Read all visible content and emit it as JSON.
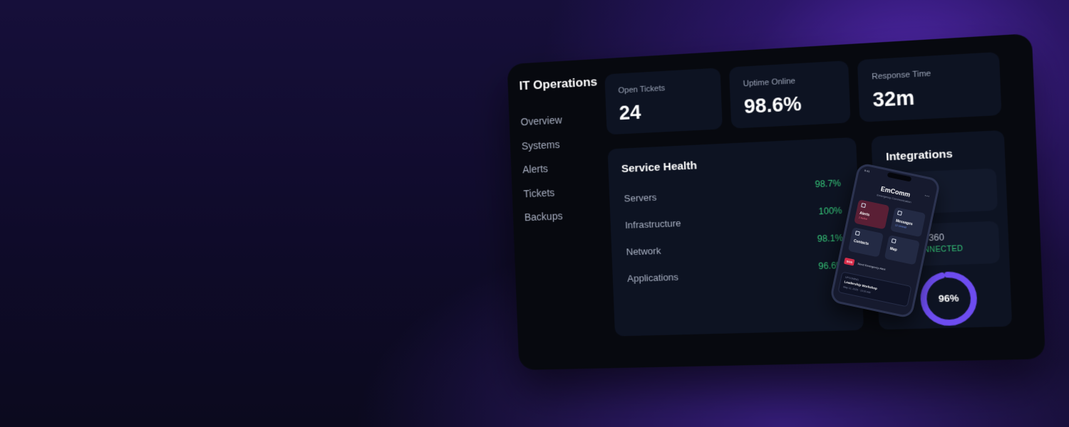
{
  "app": {
    "title": "IT Operations"
  },
  "sidebar": {
    "items": [
      {
        "label": "Overview"
      },
      {
        "label": "Systems"
      },
      {
        "label": "Alerts"
      },
      {
        "label": "Tickets"
      },
      {
        "label": "Backups"
      }
    ]
  },
  "stats": [
    {
      "label": "Open Tickets",
      "value": "24"
    },
    {
      "label": "Uptime Online",
      "value": "98.6%"
    },
    {
      "label": "Response Time",
      "value": "32m"
    }
  ],
  "service_health": {
    "title": "Service Health",
    "rows": [
      {
        "name": "Servers",
        "value": "98.7%"
      },
      {
        "name": "Infrastructure",
        "value": "100%"
      },
      {
        "name": "Network",
        "value": "98.1%"
      },
      {
        "name": "Applications",
        "value": "96.6%"
      }
    ]
  },
  "integrations": {
    "title": "Integrations",
    "items": [
      {
        "name": "",
        "status": ""
      },
      {
        "name": "LSP360",
        "status": "CONNECTED"
      }
    ],
    "score": {
      "label": "96%",
      "value": 0.96
    }
  },
  "phone": {
    "time": "9:41",
    "title": "EmComm",
    "subtitle": "Emergency Communication",
    "tiles": [
      {
        "label": "Alerts",
        "sub": "2 Active"
      },
      {
        "label": "Messages",
        "sub": "12 Unread"
      },
      {
        "label": "Contacts",
        "sub": ""
      },
      {
        "label": "Map",
        "sub": ""
      }
    ],
    "sos_badge": "SOS",
    "sos_text": "Send Emergency Alert",
    "event": {
      "kicker": "UPCOMING",
      "title": "Leadership Workshop",
      "time": "May 12, 2025 · 10:00 AM"
    }
  },
  "colors": {
    "accent": "#6d4cf0",
    "success": "#35c97a",
    "panel": "#0d1322",
    "background": "#07090f"
  }
}
